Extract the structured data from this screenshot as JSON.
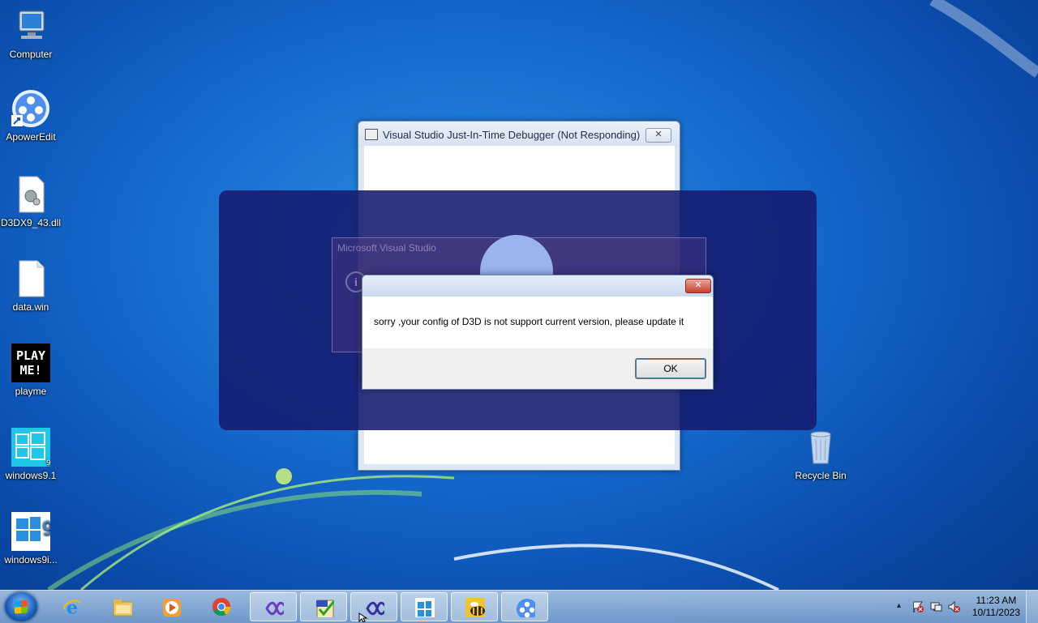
{
  "desktop": {
    "icons": [
      {
        "label": "Computer",
        "icon": "computer-icon"
      },
      {
        "label": "ApowerEdit",
        "icon": "apoweredit-icon"
      },
      {
        "label": "D3DX9_43.dll",
        "icon": "dll-file-icon"
      },
      {
        "label": "data.win",
        "icon": "file-icon"
      },
      {
        "label": "playme",
        "icon": "playme-icon",
        "image_text": "PLAY ME!"
      },
      {
        "label": "windows9.1",
        "icon": "windows9-icon"
      },
      {
        "label": "windows9i...",
        "icon": "windows9-installer-icon"
      },
      {
        "label": "Recycle Bin",
        "icon": "recycle-bin-icon"
      }
    ]
  },
  "jit_window": {
    "title": "Visual Studio Just-In-Time Debugger (Not Responding)",
    "close_label": "✕"
  },
  "background_dialog": {
    "title": "Microsoft Visual Studio",
    "info_glyph": "i"
  },
  "error_dialog": {
    "close_label": "✕",
    "message": "sorry ,your config of D3D is not support current version, please update it",
    "ok_label": "OK"
  },
  "taskbar": {
    "buttons": [
      {
        "name": "internet-explorer",
        "icon": "ie-icon",
        "active": false
      },
      {
        "name": "file-explorer",
        "icon": "folder-icon",
        "active": false
      },
      {
        "name": "media-player",
        "icon": "media-player-icon",
        "active": false
      },
      {
        "name": "chrome",
        "icon": "chrome-icon",
        "active": false
      },
      {
        "name": "visual-studio-1",
        "icon": "visual-studio-icon",
        "active": true
      },
      {
        "name": "app-checklist",
        "icon": "checklist-icon",
        "active": true
      },
      {
        "name": "visual-studio-2",
        "icon": "visual-studio-icon",
        "active": true
      },
      {
        "name": "windows9",
        "icon": "windows9-icon",
        "active": true
      },
      {
        "name": "bee-app",
        "icon": "bee-icon",
        "active": true
      },
      {
        "name": "apoweredit",
        "icon": "apoweredit-icon",
        "active": true
      }
    ],
    "tray_arrow": "▲",
    "time": "11:23 AM",
    "date": "10/11/2023"
  }
}
